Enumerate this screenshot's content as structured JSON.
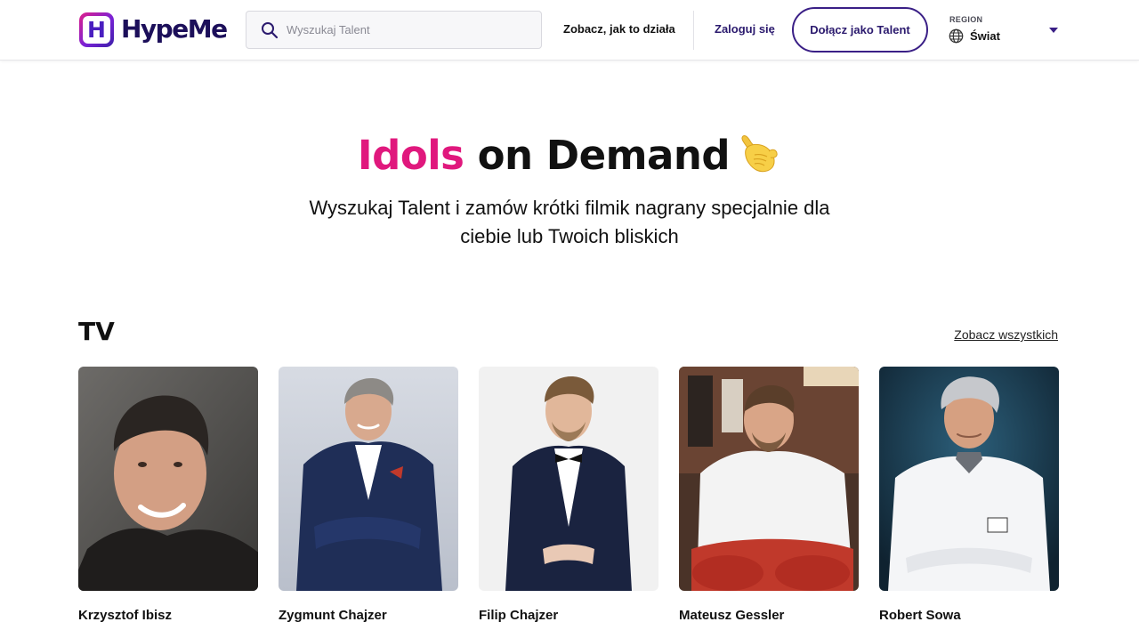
{
  "header": {
    "logo_letter": "H",
    "logo_text": "HypeMe",
    "search_placeholder": "Wyszukaj Talent",
    "nav_how_it_works": "Zobacz, jak to działa",
    "nav_login": "Zaloguj się",
    "join_button": "Dołącz jako Talent",
    "region_label": "REGION",
    "region_value": "Świat"
  },
  "hero": {
    "title_accent": "Idols",
    "title_rest": "on Demand",
    "emoji_icon": "call-me-hand-icon",
    "subtitle": "Wyszukaj Talent i zamów krótki filmik nagrany specjalnie dla ciebie lub Twoich bliskich"
  },
  "section": {
    "title": "TV",
    "see_all": "Zobacz wszystkich",
    "talents": [
      {
        "name": "Krzysztof Ibisz"
      },
      {
        "name": "Zygmunt Chajzer"
      },
      {
        "name": "Filip Chajzer"
      },
      {
        "name": "Mateusz Gessler"
      },
      {
        "name": "Robert Sowa"
      }
    ]
  },
  "colors": {
    "accent_pink": "#e0187d",
    "brand_purple": "#3a1f86",
    "text": "#111111"
  }
}
